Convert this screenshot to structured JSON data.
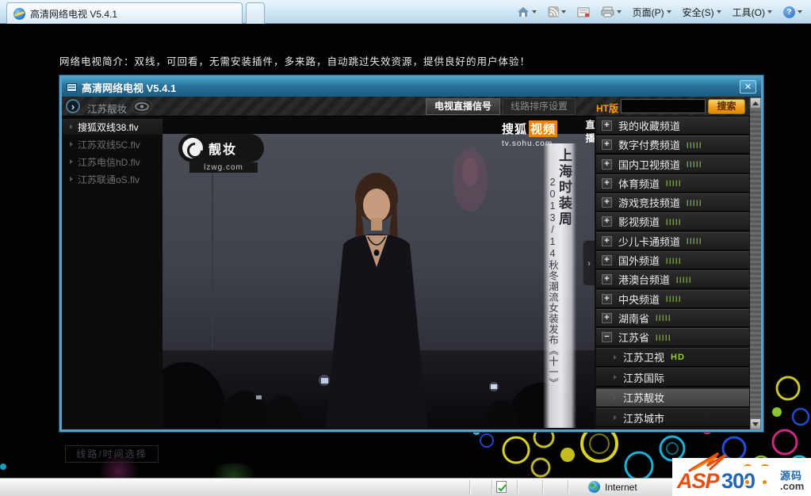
{
  "browser": {
    "tab_title": "高清网络电视 V5.4.1",
    "menus": {
      "page": "页面(P)",
      "safety": "安全(S)",
      "tools": "工具(O)",
      "help": "?"
    }
  },
  "page": {
    "intro": "网络电视简介：双线，可回看，无需安装插件，多来路，自动跳过失效资源，提供良好的用户体验！"
  },
  "player": {
    "title": "高清网络电视 V5.4.1",
    "current_channel": "江苏靓妆",
    "tabs": {
      "live": "电视直播信号",
      "sort": "线路排序设置"
    },
    "search": {
      "version": "HT版",
      "button": "搜索",
      "value": ""
    },
    "playlist": {
      "items": [
        {
          "label": "搜狐双线38.flv"
        },
        {
          "label": "江苏双线5C.flv"
        },
        {
          "label": "江苏电信hD.flv"
        },
        {
          "label": "江苏联通oS.flv"
        }
      ],
      "footer": "线路/时间选择"
    },
    "video": {
      "watermark_name": "靓妆",
      "watermark_url": "lzwg.com",
      "brand": "搜狐",
      "brand2": "视频",
      "live": "直播",
      "brand_url": "tv.sohu.com",
      "banner_title": "上海时装周",
      "banner_subtitle": "2013/14秋冬潮流女装发布《十一》"
    },
    "channels": [
      {
        "label": "我的收藏频道",
        "expand": "+",
        "bars": ""
      },
      {
        "label": "数字付费频道",
        "expand": "+",
        "bars": "IIIII"
      },
      {
        "label": "国内卫视频道",
        "expand": "+",
        "bars": "IIIII"
      },
      {
        "label": "体育频道",
        "expand": "+",
        "bars": "IIIII"
      },
      {
        "label": "游戏竞技频道",
        "expand": "+",
        "bars": "IIIII"
      },
      {
        "label": "影视频道",
        "expand": "+",
        "bars": "IIIII"
      },
      {
        "label": "少儿卡通频道",
        "expand": "+",
        "bars": "IIIII"
      },
      {
        "label": "国外频道",
        "expand": "+",
        "bars": "IIIII"
      },
      {
        "label": "港澳台频道",
        "expand": "+",
        "bars": "IIIII"
      },
      {
        "label": "中央频道",
        "expand": "+",
        "bars": "IIIII"
      },
      {
        "label": "湖南省",
        "expand": "+",
        "bars": "IIIII"
      },
      {
        "label": "江苏省",
        "expand": "−",
        "bars": "IIIII"
      }
    ],
    "subchannels": [
      {
        "label": "江苏卫视",
        "badge": "HD"
      },
      {
        "label": "江苏国际"
      },
      {
        "label": "江苏靓妆"
      },
      {
        "label": "江苏城市"
      }
    ]
  },
  "statusbar": {
    "zone": "Internet"
  },
  "logo": {
    "asp": "ASP",
    "num": "300",
    "cn": "源码",
    "tld": ".com"
  },
  "icons": {
    "close": "✕",
    "chevron": "›",
    "collapse": "›"
  }
}
